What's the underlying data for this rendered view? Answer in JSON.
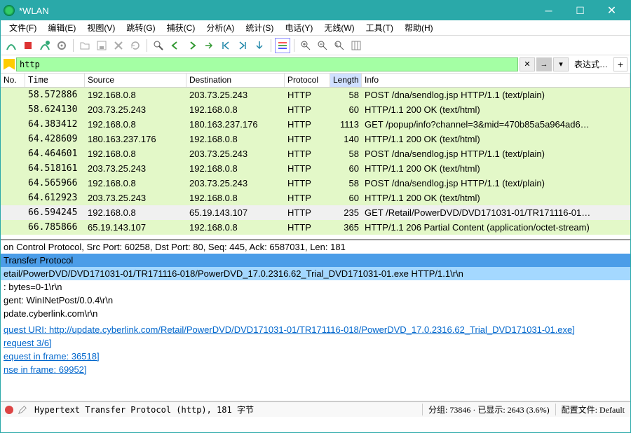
{
  "window": {
    "title": "*WLAN"
  },
  "menu": [
    "文件(F)",
    "编辑(E)",
    "视图(V)",
    "跳转(G)",
    "捕获(C)",
    "分析(A)",
    "统计(S)",
    "电话(Y)",
    "无线(W)",
    "工具(T)",
    "帮助(H)"
  ],
  "filter": {
    "value": "http",
    "expr_label": "表达式…"
  },
  "columns": {
    "no": "No.",
    "time": "Time",
    "source": "Source",
    "destination": "Destination",
    "protocol": "Protocol",
    "length": "Length",
    "info": "Info"
  },
  "packets": [
    {
      "time": "58.572886",
      "src": "192.168.0.8",
      "dst": "203.73.25.243",
      "proto": "HTTP",
      "len": "58",
      "info": "POST /dna/sendlog.jsp HTTP/1.1  (text/plain)",
      "sel": false
    },
    {
      "time": "58.624130",
      "src": "203.73.25.243",
      "dst": "192.168.0.8",
      "proto": "HTTP",
      "len": "60",
      "info": "HTTP/1.1 200 OK  (text/html)",
      "sel": false
    },
    {
      "time": "64.383412",
      "src": "192.168.0.8",
      "dst": "180.163.237.176",
      "proto": "HTTP",
      "len": "1113",
      "info": "GET /popup/info?channel=3&mid=470b85a5a964ad6…",
      "sel": false
    },
    {
      "time": "64.428609",
      "src": "180.163.237.176",
      "dst": "192.168.0.8",
      "proto": "HTTP",
      "len": "140",
      "info": "HTTP/1.1 200 OK  (text/html)",
      "sel": false
    },
    {
      "time": "64.464601",
      "src": "192.168.0.8",
      "dst": "203.73.25.243",
      "proto": "HTTP",
      "len": "58",
      "info": "POST /dna/sendlog.jsp HTTP/1.1  (text/plain)",
      "sel": false
    },
    {
      "time": "64.518161",
      "src": "203.73.25.243",
      "dst": "192.168.0.8",
      "proto": "HTTP",
      "len": "60",
      "info": "HTTP/1.1 200 OK  (text/html)",
      "sel": false
    },
    {
      "time": "64.565966",
      "src": "192.168.0.8",
      "dst": "203.73.25.243",
      "proto": "HTTP",
      "len": "58",
      "info": "POST /dna/sendlog.jsp HTTP/1.1  (text/plain)",
      "sel": false
    },
    {
      "time": "64.612923",
      "src": "203.73.25.243",
      "dst": "192.168.0.8",
      "proto": "HTTP",
      "len": "60",
      "info": "HTTP/1.1 200 OK  (text/html)",
      "sel": false
    },
    {
      "time": "66.594245",
      "src": "192.168.0.8",
      "dst": "65.19.143.107",
      "proto": "HTTP",
      "len": "235",
      "info": "GET /Retail/PowerDVD/DVD171031-01/TR171116-01…",
      "sel": true
    },
    {
      "time": "66.785866",
      "src": "65.19.143.107",
      "dst": "192.168.0.8",
      "proto": "HTTP",
      "len": "365",
      "info": "HTTP/1.1 206 Partial Content  (application/octet-stream)",
      "sel": false
    }
  ],
  "detail": {
    "l0": "on Control Protocol, Src Port: 60258, Dst Port: 80, Seq: 445, Ack: 6587031, Len: 181",
    "l1": "Transfer Protocol",
    "l2": "etail/PowerDVD/DVD171031-01/TR171116-018/PowerDVD_17.0.2316.62_Trial_DVD171031-01.exe HTTP/1.1\\r\\n",
    "l3": ": bytes=0-1\\r\\n",
    "l4": "gent: WinINetPost/0.0.4\\r\\n",
    "l5": "pdate.cyberlink.com\\r\\n",
    "l6": "",
    "l7": "quest URI: http://update.cyberlink.com/Retail/PowerDVD/DVD171031-01/TR171116-018/PowerDVD_17.0.2316.62_Trial_DVD171031-01.exe]",
    "l8": "request 3/6]",
    "l9": "equest in frame: 36518]",
    "l10": "nse in frame: 69952]"
  },
  "status": {
    "main": "Hypertext Transfer Protocol (http), 181 字节",
    "packets": "分组: 73846 · 已显示: 2643 (3.6%)",
    "profile": "配置文件: Default"
  }
}
